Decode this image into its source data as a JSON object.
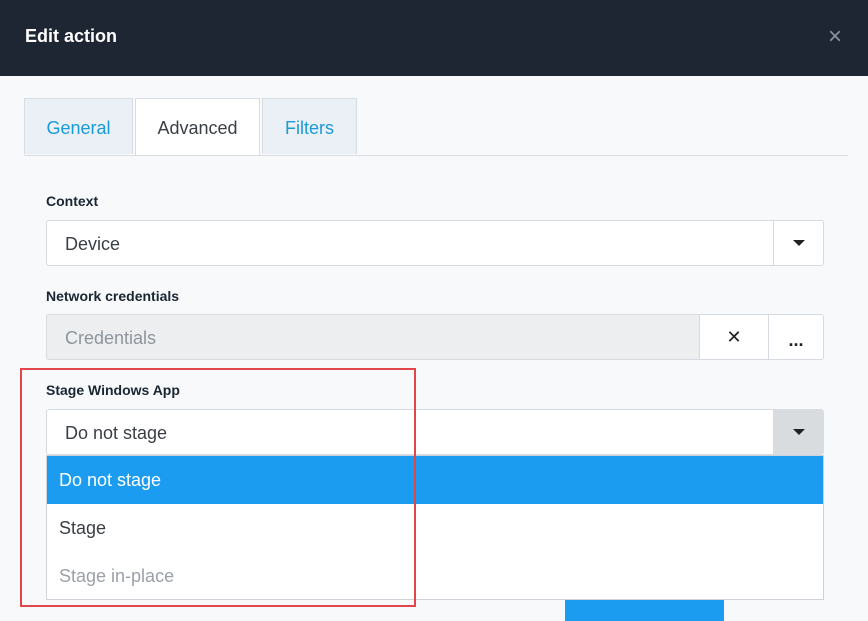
{
  "dialog": {
    "title": "Edit action",
    "close_symbol": "×"
  },
  "tabs": [
    {
      "label": "General",
      "active": false
    },
    {
      "label": "Advanced",
      "active": true
    },
    {
      "label": "Filters",
      "active": false
    }
  ],
  "context": {
    "label": "Context",
    "value": "Device",
    "icon": "caret-down-icon"
  },
  "network_credentials": {
    "label": "Network credentials",
    "placeholder": "Credentials",
    "clear_symbol": "✕",
    "browse_symbol": "..."
  },
  "stage_windows_app": {
    "label": "Stage Windows App",
    "value": "Do not stage",
    "options": [
      {
        "label": "Do not stage",
        "state": "selected"
      },
      {
        "label": "Stage",
        "state": "normal"
      },
      {
        "label": "Stage in-place",
        "state": "disabled"
      }
    ]
  },
  "colors": {
    "header_bg": "#1f2633",
    "accent": "#1b9cf0",
    "tab_link": "#1b9ad8",
    "annotation_red": "#e0464a"
  }
}
